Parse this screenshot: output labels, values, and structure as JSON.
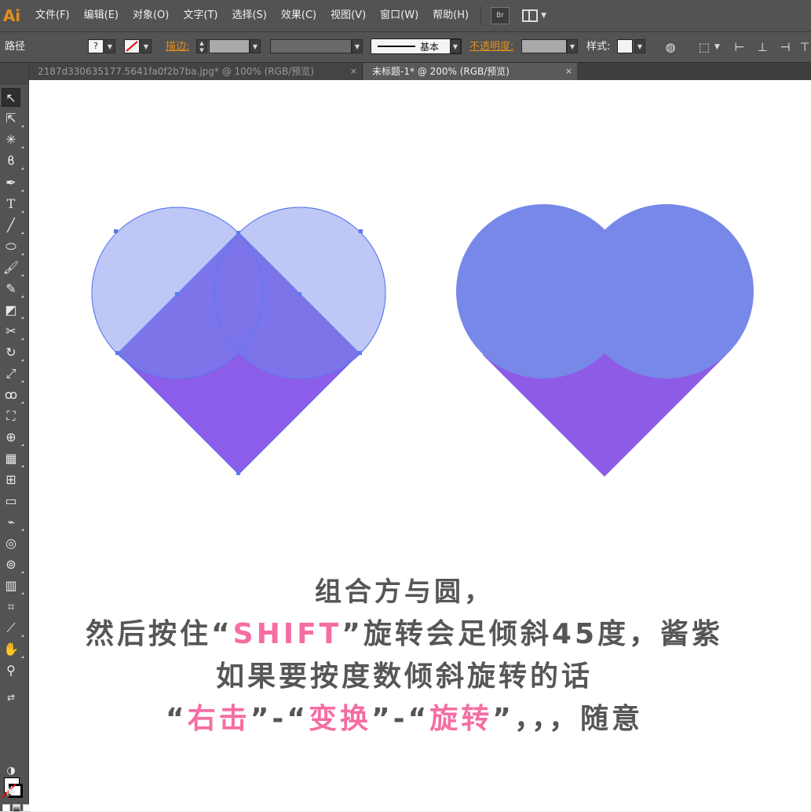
{
  "app": {
    "logo": "Ai"
  },
  "menubar": {
    "items": [
      "文件(F)",
      "编辑(E)",
      "对象(O)",
      "文字(T)",
      "选择(S)",
      "效果(C)",
      "视图(V)",
      "窗口(W)",
      "帮助(H)"
    ],
    "bridge_label": "Br"
  },
  "controlbar": {
    "selection_label": "路径",
    "fill_swatch": "?",
    "stroke_label": "描边:",
    "stroke_style_label": "基本",
    "opacity_label": "不透明度:",
    "style_label": "样式:"
  },
  "tabs": [
    {
      "title": "2187d330635177.5641fa0f2b7ba.jpg* @ 100% (RGB/预览)",
      "close": "×",
      "active": false
    },
    {
      "title": "未标题-1* @ 200% (RGB/预览)",
      "close": "×",
      "active": true
    }
  ],
  "tools": [
    "selection-tool",
    "direct-selection-tool",
    "magic-wand-tool",
    "lasso-tool",
    "pen-tool",
    "type-tool",
    "line-tool",
    "ellipse-tool",
    "paintbrush-tool",
    "pencil-tool",
    "eraser-tool",
    "scissors-tool",
    "rotate-tool",
    "scale-tool",
    "warp-tool",
    "free-transform-tool",
    "shape-builder-tool",
    "perspective-grid-tool",
    "mesh-tool",
    "gradient-tool",
    "eyedropper-tool",
    "blend-tool",
    "symbol-sprayer-tool",
    "column-graph-tool",
    "artboard-tool",
    "slice-tool",
    "hand-tool",
    "zoom-tool"
  ],
  "colors": {
    "circle_fill": "#bac4f4",
    "circle_stroke": "#5b79f0",
    "square_fill": "#8b5de8",
    "overlap_fill": "#7c74e8",
    "heart_top": "#7888e8",
    "heart_bottom": "#8c5ce6",
    "caption_gray": "#565656",
    "caption_pink": "#f56da3"
  },
  "caption": {
    "line1": "组合方与圆，",
    "line2_a": "然后按住“",
    "line2_hl": "SHIFT",
    "line2_b": "”旋转会足倾斜45度，酱紫",
    "line3": "如果要按度数倾斜旋转的话",
    "line4_q1": "“",
    "line4_hl1": "右击",
    "line4_q2": "”-“",
    "line4_hl2": "变换",
    "line4_q3": "”-“",
    "line4_hl3": "旋转",
    "line4_tail": "”，，，随意"
  }
}
